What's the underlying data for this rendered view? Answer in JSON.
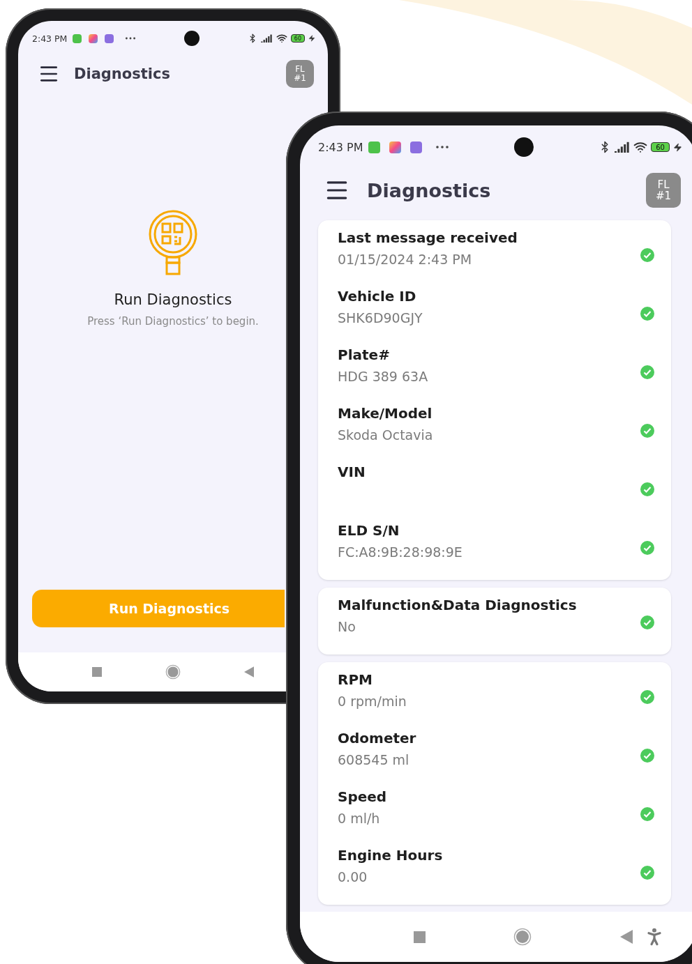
{
  "phones": [
    {
      "kind": "start",
      "status": {
        "time": "2:43 PM",
        "battery": "60"
      },
      "header": {
        "title": "Diagnostics",
        "badge": [
          "FL",
          "#1"
        ]
      },
      "empty_state": {
        "title": "Run Diagnostics",
        "hint": "Press ‘Run Diagnostics’ to begin."
      },
      "action_button": "Run Diagnostics",
      "nav": [
        {
          "kind": "recents"
        },
        {
          "kind": "home"
        },
        {
          "kind": "back"
        }
      ]
    },
    {
      "kind": "results",
      "status": {
        "time": "2:43 PM",
        "battery": "60"
      },
      "header": {
        "title": "Diagnostics",
        "badge": [
          "FL",
          "#1"
        ]
      },
      "cards": [
        [
          {
            "label": "Last message received",
            "value": "01/15/2024  2:43 PM",
            "ok": true
          },
          {
            "label": "Vehicle ID",
            "value": "SHK6D90GJY",
            "ok": true
          },
          {
            "label": "Plate#",
            "value": "HDG 389 63A",
            "ok": true
          },
          {
            "label": "Make/Model",
            "value": "Skoda Octavia",
            "ok": true
          },
          {
            "label": "VIN",
            "ok": true
          },
          {
            "label": "ELD S/N",
            "value": "FC:A8:9B:28:98:9E",
            "ok": true
          }
        ],
        [
          {
            "label": "Malfunction&Data Diagnostics",
            "value": "No",
            "ok": true
          }
        ],
        [
          {
            "label": "RPM",
            "value": "0 rpm/min",
            "ok": true
          },
          {
            "label": "Odometer",
            "value": "608545 ml",
            "ok": true
          },
          {
            "label": "Speed",
            "value": "0 ml/h",
            "ok": true
          },
          {
            "label": "Engine Hours",
            "value": "0.00",
            "ok": true
          }
        ]
      ],
      "nav": [
        {
          "kind": "recents"
        },
        {
          "kind": "home"
        },
        {
          "kind": "back"
        },
        {
          "kind": "accessibility"
        }
      ]
    }
  ]
}
